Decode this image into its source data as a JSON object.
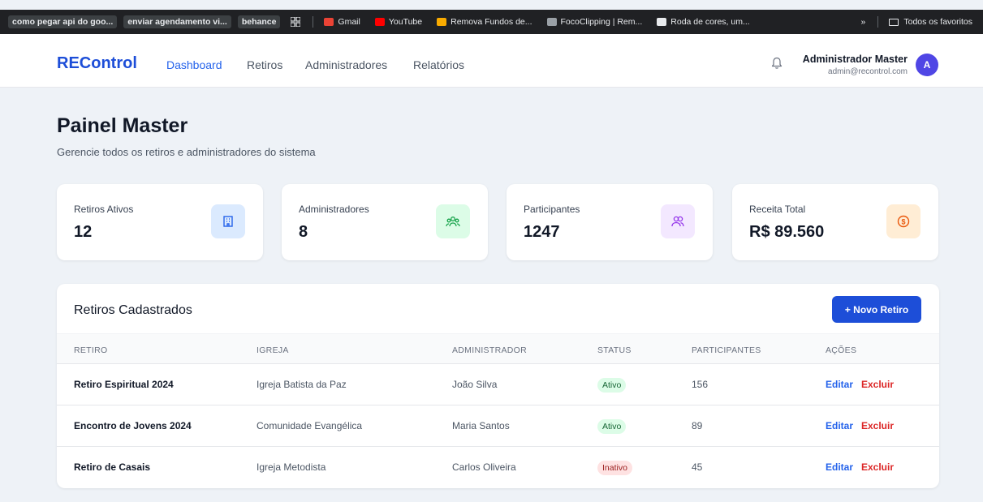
{
  "bookmarks": {
    "items": [
      {
        "label": "como pegar api do goo...",
        "style": "box"
      },
      {
        "label": "enviar agendamento vi...",
        "style": "box"
      },
      {
        "label": "behance",
        "style": "box"
      }
    ],
    "links": [
      {
        "label": "Gmail",
        "icon": "gmail-icon",
        "color": "#ea4335"
      },
      {
        "label": "YouTube",
        "icon": "youtube-icon",
        "color": "#ff0000"
      },
      {
        "label": "Remova Fundos de...",
        "icon": "removebg-icon",
        "color": "#f9ab00"
      },
      {
        "label": "FocoClipping | Rem...",
        "icon": "fococlipping-icon",
        "color": "#9aa0a6"
      },
      {
        "label": "Roda de cores, um...",
        "icon": "color-wheel-icon",
        "color": "#e8eaed"
      }
    ],
    "more": "»",
    "all_bookmarks": "Todos os favoritos"
  },
  "navbar": {
    "brand": "REControl",
    "links": [
      "Dashboard",
      "Retiros",
      "Administradores",
      "Relatórios"
    ],
    "user_name": "Administrador Master",
    "user_email": "admin@recontrol.com",
    "avatar_initial": "A"
  },
  "header": {
    "title": "Painel Master",
    "subtitle": "Gerencie todos os retiros e administradores do sistema"
  },
  "stats": [
    {
      "label": "Retiros Ativos",
      "value": "12",
      "icon": "building-icon",
      "icon_bg": "#dbeafe",
      "icon_color": "#2563eb"
    },
    {
      "label": "Administradores",
      "value": "8",
      "icon": "users-group-icon",
      "icon_bg": "#dcfce7",
      "icon_color": "#16a34a"
    },
    {
      "label": "Participantes",
      "value": "1247",
      "icon": "users-icon",
      "icon_bg": "#f3e8ff",
      "icon_color": "#9333ea"
    },
    {
      "label": "Receita Total",
      "value": "R$ 89.560",
      "icon": "dollar-icon",
      "icon_bg": "#ffedd5",
      "icon_color": "#ea580c"
    }
  ],
  "table": {
    "title": "Retiros Cadastrados",
    "new_button": "+ Novo Retiro",
    "columns": [
      "RETIRO",
      "IGREJA",
      "ADMINISTRADOR",
      "STATUS",
      "PARTICIPANTES",
      "AÇÕES"
    ],
    "rows": [
      {
        "retiro": "Retiro Espiritual 2024",
        "igreja": "Igreja Batista da Paz",
        "administrador": "João Silva",
        "status": "Ativo",
        "participantes": "156",
        "edit": "Editar",
        "delete": "Excluir"
      },
      {
        "retiro": "Encontro de Jovens 2024",
        "igreja": "Comunidade Evangélica",
        "administrador": "Maria Santos",
        "status": "Ativo",
        "participantes": "89",
        "edit": "Editar",
        "delete": "Excluir"
      },
      {
        "retiro": "Retiro de Casais",
        "igreja": "Igreja Metodista",
        "administrador": "Carlos Oliveira",
        "status": "Inativo",
        "participantes": "45",
        "edit": "Editar",
        "delete": "Excluir"
      }
    ]
  }
}
